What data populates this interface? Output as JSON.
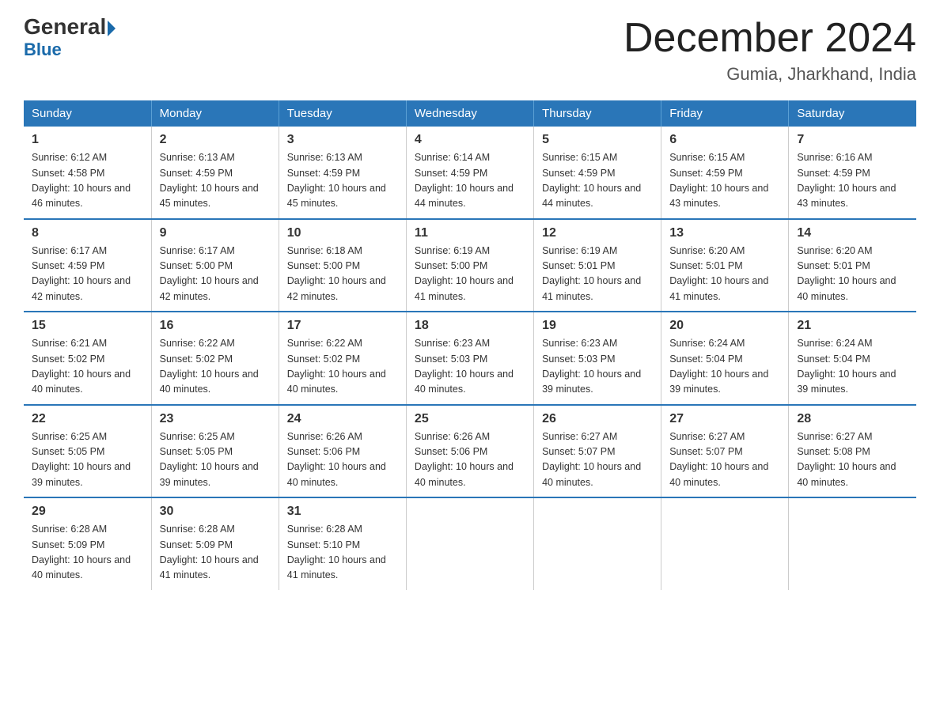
{
  "logo": {
    "general": "General",
    "blue": "Blue"
  },
  "header": {
    "month": "December 2024",
    "location": "Gumia, Jharkhand, India"
  },
  "weekdays": [
    "Sunday",
    "Monday",
    "Tuesday",
    "Wednesday",
    "Thursday",
    "Friday",
    "Saturday"
  ],
  "weeks": [
    [
      {
        "day": "1",
        "sunrise": "6:12 AM",
        "sunset": "4:58 PM",
        "daylight": "10 hours and 46 minutes."
      },
      {
        "day": "2",
        "sunrise": "6:13 AM",
        "sunset": "4:59 PM",
        "daylight": "10 hours and 45 minutes."
      },
      {
        "day": "3",
        "sunrise": "6:13 AM",
        "sunset": "4:59 PM",
        "daylight": "10 hours and 45 minutes."
      },
      {
        "day": "4",
        "sunrise": "6:14 AM",
        "sunset": "4:59 PM",
        "daylight": "10 hours and 44 minutes."
      },
      {
        "day": "5",
        "sunrise": "6:15 AM",
        "sunset": "4:59 PM",
        "daylight": "10 hours and 44 minutes."
      },
      {
        "day": "6",
        "sunrise": "6:15 AM",
        "sunset": "4:59 PM",
        "daylight": "10 hours and 43 minutes."
      },
      {
        "day": "7",
        "sunrise": "6:16 AM",
        "sunset": "4:59 PM",
        "daylight": "10 hours and 43 minutes."
      }
    ],
    [
      {
        "day": "8",
        "sunrise": "6:17 AM",
        "sunset": "4:59 PM",
        "daylight": "10 hours and 42 minutes."
      },
      {
        "day": "9",
        "sunrise": "6:17 AM",
        "sunset": "5:00 PM",
        "daylight": "10 hours and 42 minutes."
      },
      {
        "day": "10",
        "sunrise": "6:18 AM",
        "sunset": "5:00 PM",
        "daylight": "10 hours and 42 minutes."
      },
      {
        "day": "11",
        "sunrise": "6:19 AM",
        "sunset": "5:00 PM",
        "daylight": "10 hours and 41 minutes."
      },
      {
        "day": "12",
        "sunrise": "6:19 AM",
        "sunset": "5:01 PM",
        "daylight": "10 hours and 41 minutes."
      },
      {
        "day": "13",
        "sunrise": "6:20 AM",
        "sunset": "5:01 PM",
        "daylight": "10 hours and 41 minutes."
      },
      {
        "day": "14",
        "sunrise": "6:20 AM",
        "sunset": "5:01 PM",
        "daylight": "10 hours and 40 minutes."
      }
    ],
    [
      {
        "day": "15",
        "sunrise": "6:21 AM",
        "sunset": "5:02 PM",
        "daylight": "10 hours and 40 minutes."
      },
      {
        "day": "16",
        "sunrise": "6:22 AM",
        "sunset": "5:02 PM",
        "daylight": "10 hours and 40 minutes."
      },
      {
        "day": "17",
        "sunrise": "6:22 AM",
        "sunset": "5:02 PM",
        "daylight": "10 hours and 40 minutes."
      },
      {
        "day": "18",
        "sunrise": "6:23 AM",
        "sunset": "5:03 PM",
        "daylight": "10 hours and 40 minutes."
      },
      {
        "day": "19",
        "sunrise": "6:23 AM",
        "sunset": "5:03 PM",
        "daylight": "10 hours and 39 minutes."
      },
      {
        "day": "20",
        "sunrise": "6:24 AM",
        "sunset": "5:04 PM",
        "daylight": "10 hours and 39 minutes."
      },
      {
        "day": "21",
        "sunrise": "6:24 AM",
        "sunset": "5:04 PM",
        "daylight": "10 hours and 39 minutes."
      }
    ],
    [
      {
        "day": "22",
        "sunrise": "6:25 AM",
        "sunset": "5:05 PM",
        "daylight": "10 hours and 39 minutes."
      },
      {
        "day": "23",
        "sunrise": "6:25 AM",
        "sunset": "5:05 PM",
        "daylight": "10 hours and 39 minutes."
      },
      {
        "day": "24",
        "sunrise": "6:26 AM",
        "sunset": "5:06 PM",
        "daylight": "10 hours and 40 minutes."
      },
      {
        "day": "25",
        "sunrise": "6:26 AM",
        "sunset": "5:06 PM",
        "daylight": "10 hours and 40 minutes."
      },
      {
        "day": "26",
        "sunrise": "6:27 AM",
        "sunset": "5:07 PM",
        "daylight": "10 hours and 40 minutes."
      },
      {
        "day": "27",
        "sunrise": "6:27 AM",
        "sunset": "5:07 PM",
        "daylight": "10 hours and 40 minutes."
      },
      {
        "day": "28",
        "sunrise": "6:27 AM",
        "sunset": "5:08 PM",
        "daylight": "10 hours and 40 minutes."
      }
    ],
    [
      {
        "day": "29",
        "sunrise": "6:28 AM",
        "sunset": "5:09 PM",
        "daylight": "10 hours and 40 minutes."
      },
      {
        "day": "30",
        "sunrise": "6:28 AM",
        "sunset": "5:09 PM",
        "daylight": "10 hours and 41 minutes."
      },
      {
        "day": "31",
        "sunrise": "6:28 AM",
        "sunset": "5:10 PM",
        "daylight": "10 hours and 41 minutes."
      },
      null,
      null,
      null,
      null
    ]
  ]
}
